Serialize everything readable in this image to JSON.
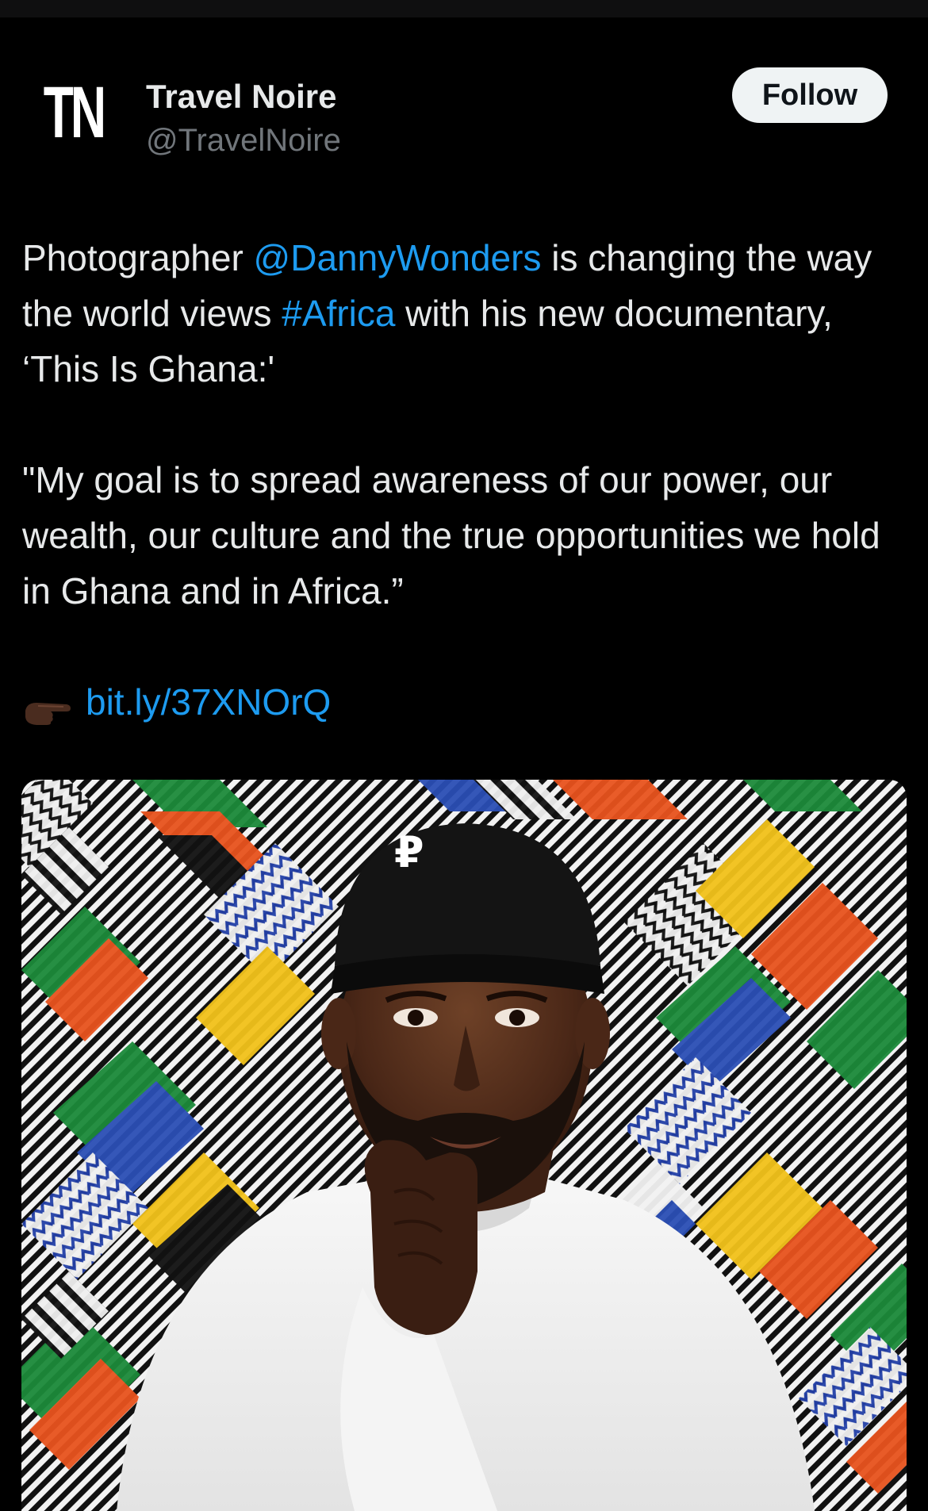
{
  "author": {
    "avatar_text": "TN",
    "display_name": "Travel Noire",
    "handle": "@TravelNoire"
  },
  "follow_button": {
    "label": "Follow"
  },
  "tweet": {
    "para1": {
      "before_mention": "Photographer ",
      "mention": "@DannyWonders",
      "after_mention": " is changing the way the world views ",
      "hashtag": "#Africa",
      "after_hashtag": " with his new documentary, ‘This Is Ghana:'"
    },
    "para2": "\"My goal is to spread awareness of our power, our wealth, our culture and the true opportunities we hold in Ghana and in Africa.”",
    "link": {
      "emoji": "pointing-right-hand-emoji",
      "text": "bit.ly/37XNOrQ"
    }
  },
  "media": {
    "icon": "photo",
    "cap_logo": "₽"
  },
  "colors": {
    "background": "#000000",
    "text": "#e7e9ea",
    "secondary_text": "#71767b",
    "link": "#1d9bf0",
    "follow_bg": "#eff3f4"
  }
}
